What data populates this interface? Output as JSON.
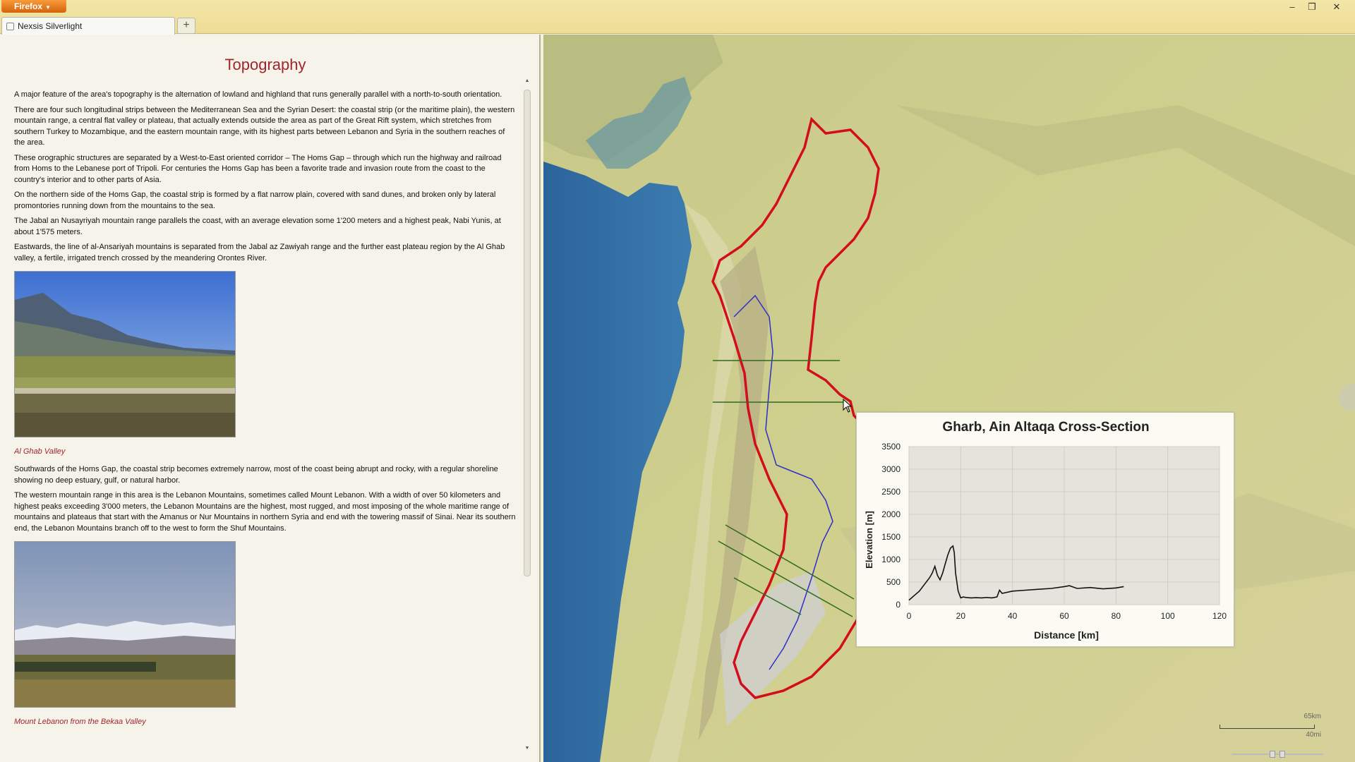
{
  "browser": {
    "menu_label": "Firefox",
    "tab_title": "Nexsis Silverlight",
    "new_tab": "+",
    "controls": {
      "minimize": "‒",
      "restore": "❐",
      "close": "✕"
    }
  },
  "article": {
    "title": "Topography",
    "paragraphs": [
      "A major feature of the area's topography is the alternation of lowland and highland that runs generally parallel with a north-to-south orientation.",
      "There are four such longitudinal strips between the Mediterranean Sea and the Syrian Desert: the coastal strip (or the maritime plain), the western mountain range, a central flat valley or plateau, that actually extends outside the area as part of the Great Rift system, which stretches from southern Turkey to Mozambique, and the eastern mountain range, with its highest parts between Lebanon and Syria in the southern reaches of the area.",
      "These orographic structures are separated by a West-to-East oriented corridor – The Homs Gap – through which run the highway and railroad from Homs to the Lebanese port of Tripoli. For centuries the Homs Gap has been a favorite trade and invasion route from the coast to the country's interior and to other parts of Asia.",
      "On the northern side of the Homs Gap, the coastal strip is formed by a flat narrow plain, covered with sand dunes, and broken only by lateral promontories running down from the mountains to the sea.",
      "The Jabal an Nusayriyah mountain range parallels the coast, with an average elevation some 1'200 meters and a highest peak, Nabi Yunis, at about 1'575 meters.",
      "Eastwards, the line of al-Ansariyah mountains is separated from the Jabal az Zawiyah range and the further east plateau region by the Al Ghab valley, a fertile, irrigated trench crossed by the meandering Orontes River."
    ],
    "caption1": "Al Ghab Valley",
    "paragraphs2": [
      "Southwards of the Homs Gap, the coastal strip becomes extremely narrow, most of the coast being abrupt and rocky, with a regular shoreline showing no deep estuary, gulf, or natural harbor.",
      "The western mountain range in this area is the Lebanon Mountains, sometimes called Mount Lebanon. With a width of over 50 kilometers and highest peaks exceeding 3'000 meters, the Lebanon Mountains are the highest, most rugged, and most imposing of the whole maritime range of mountains and plateaus that start with the Amanus or Nur Mountains in northern Syria and end with the towering massif of Sinai. Near its southern end, the Lebanon Mountains branch off to the west to form the Shuf Mountains."
    ],
    "caption2": "Mount Lebanon from the Bekaa Valley"
  },
  "map": {
    "scale_km": "65km",
    "scale_mi": "40mi",
    "colors": {
      "sea": "#2f6ea3",
      "land_low": "#cbcf8c",
      "border": "#d0101c",
      "river": "#2d2fc8",
      "section_line": "#2e6b1e"
    }
  },
  "chart_data": {
    "type": "line",
    "title": "Gharb, Ain Altaqa Cross-Section",
    "xlabel": "Distance [km]",
    "ylabel": "Elevation [m]",
    "xlim": [
      0,
      120
    ],
    "ylim": [
      0,
      3500
    ],
    "xticks": [
      0,
      20,
      40,
      60,
      80,
      100,
      120
    ],
    "yticks": [
      0,
      500,
      1000,
      1500,
      2000,
      2500,
      3000,
      3500
    ],
    "grid": true,
    "series": [
      {
        "x": [
          0,
          2,
          4,
          6,
          8,
          9,
          10,
          11,
          12,
          13,
          14,
          15,
          16,
          17,
          17.5,
          18,
          19,
          20,
          21,
          22,
          24,
          26,
          28,
          30,
          32,
          34,
          35,
          36,
          40,
          45,
          50,
          55,
          60,
          62,
          65,
          70,
          75,
          80,
          83
        ],
        "y": [
          100,
          200,
          300,
          450,
          600,
          700,
          850,
          650,
          550,
          700,
          900,
          1100,
          1250,
          1300,
          1150,
          700,
          300,
          150,
          170,
          160,
          150,
          155,
          150,
          160,
          150,
          170,
          320,
          250,
          300,
          320,
          340,
          360,
          400,
          420,
          360,
          380,
          350,
          370,
          400
        ]
      }
    ]
  }
}
